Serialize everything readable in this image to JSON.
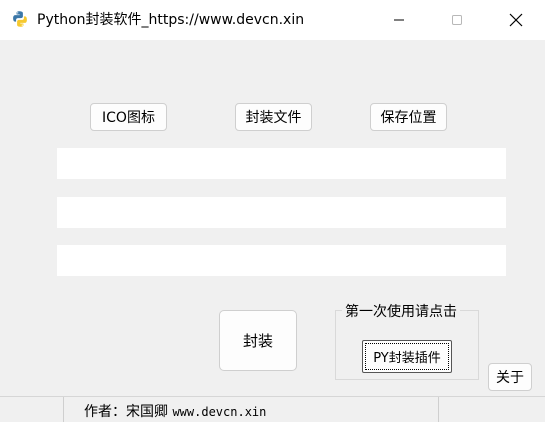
{
  "window": {
    "title": "Python封装软件_https://www.devcn.xin",
    "icon": "python-logo-icon",
    "controls": [
      "minimize-icon",
      "maximize-icon",
      "close-icon"
    ]
  },
  "toolbar": {
    "ico_label": "ICO图标",
    "file_label": "封装文件",
    "save_label": "保存位置"
  },
  "fields": {
    "ico_path": "",
    "file_path": "",
    "save_path": ""
  },
  "actions": {
    "pack_label": "封装",
    "about_label": "关于"
  },
  "first_use": {
    "title": "第一次使用请点击",
    "button_label": "PY封装插件"
  },
  "statusbar": {
    "author": "作者：宋国卿",
    "url": "www.devcn.xin"
  },
  "colors": {
    "background": "#f0f0f0",
    "titlebar": "#ffffff",
    "python_blue": "#3b77a8",
    "python_yellow": "#f6c92f"
  }
}
